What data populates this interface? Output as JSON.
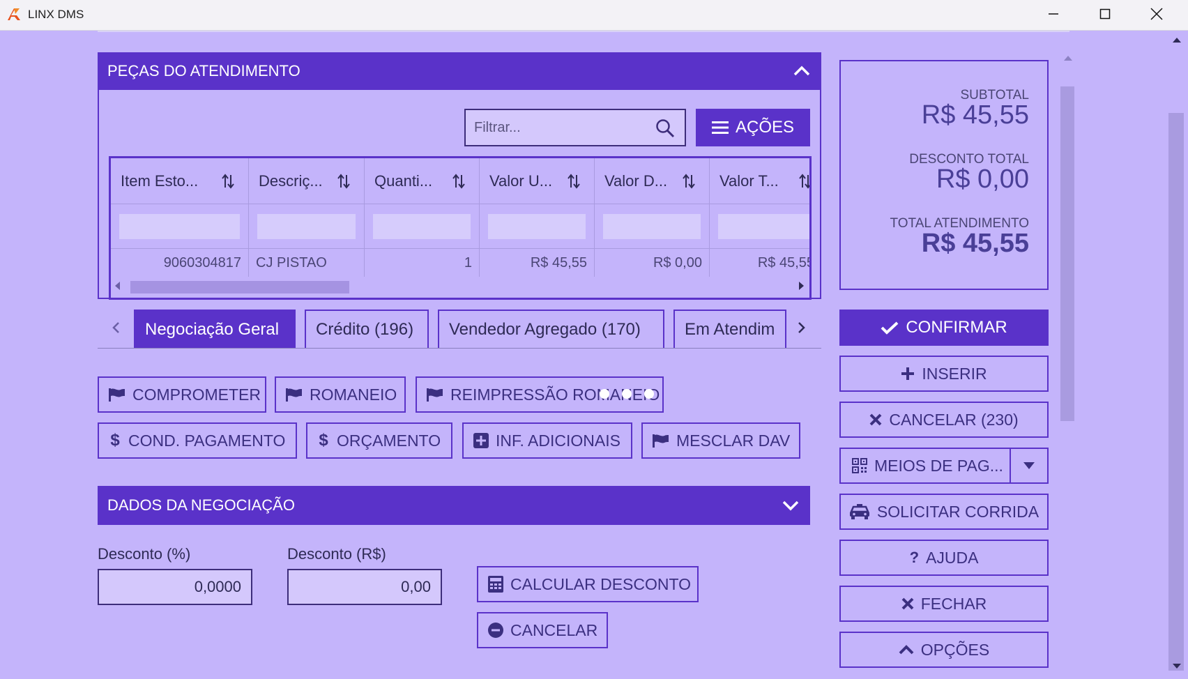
{
  "window": {
    "title": "LINX DMS"
  },
  "pecas": {
    "title": "PEÇAS DO ATENDIMENTO",
    "filter_placeholder": "Filtrar...",
    "acoes_label": "AÇÕES",
    "columns": [
      "Item Esto...",
      "Descriç...",
      "Quanti...",
      "Valor U...",
      "Valor D...",
      "Valor T..."
    ],
    "rows": [
      {
        "item": "9060304817",
        "descricao": "CJ PISTAO",
        "quantidade": "1",
        "valor_unit": "R$ 45,55",
        "valor_desc": "R$ 0,00",
        "valor_total": "R$ 45,55"
      }
    ]
  },
  "tabs": [
    "Negociação Geral",
    "Crédito (196)",
    "Vendedor Agregado (170)",
    "Em Atendim"
  ],
  "actions": {
    "comprometer": "COMPROMETER",
    "romaneio": "ROMANEIO",
    "reimpressao": "REIMPRESSÃO ROMANEIO",
    "cond_pagamento": "COND. PAGAMENTO",
    "orcamento": "ORÇAMENTO",
    "inf_adicionais": "INF. ADICIONAIS",
    "mesclar_dav": "MESCLAR DAV"
  },
  "dados": {
    "title": "DADOS DA NEGOCIAÇÃO",
    "desconto_pct_label": "Desconto (%)",
    "desconto_pct_value": "0,0000",
    "desconto_rs_label": "Desconto (R$)",
    "desconto_rs_value": "0,00",
    "calcular_label": "CALCULAR DESCONTO",
    "cancelar_label": "CANCELAR"
  },
  "totals": {
    "subtotal_label": "SUBTOTAL",
    "subtotal_value": "R$ 45,55",
    "desconto_label": "DESCONTO TOTAL",
    "desconto_value": "R$ 0,00",
    "total_label": "TOTAL ATENDIMENTO",
    "total_value": "R$ 45,55"
  },
  "sidebar": {
    "confirmar": "CONFIRMAR",
    "inserir": "INSERIR",
    "cancelar": "CANCELAR (230)",
    "meios_pag": "MEIOS DE PAG...",
    "solicitar_corrida": "SOLICITAR CORRIDA",
    "ajuda": "AJUDA",
    "fechar": "FECHAR",
    "opcoes": "OPÇÕES"
  },
  "colors": {
    "accent": "#5a32c9",
    "background": "#c4b4fb"
  }
}
